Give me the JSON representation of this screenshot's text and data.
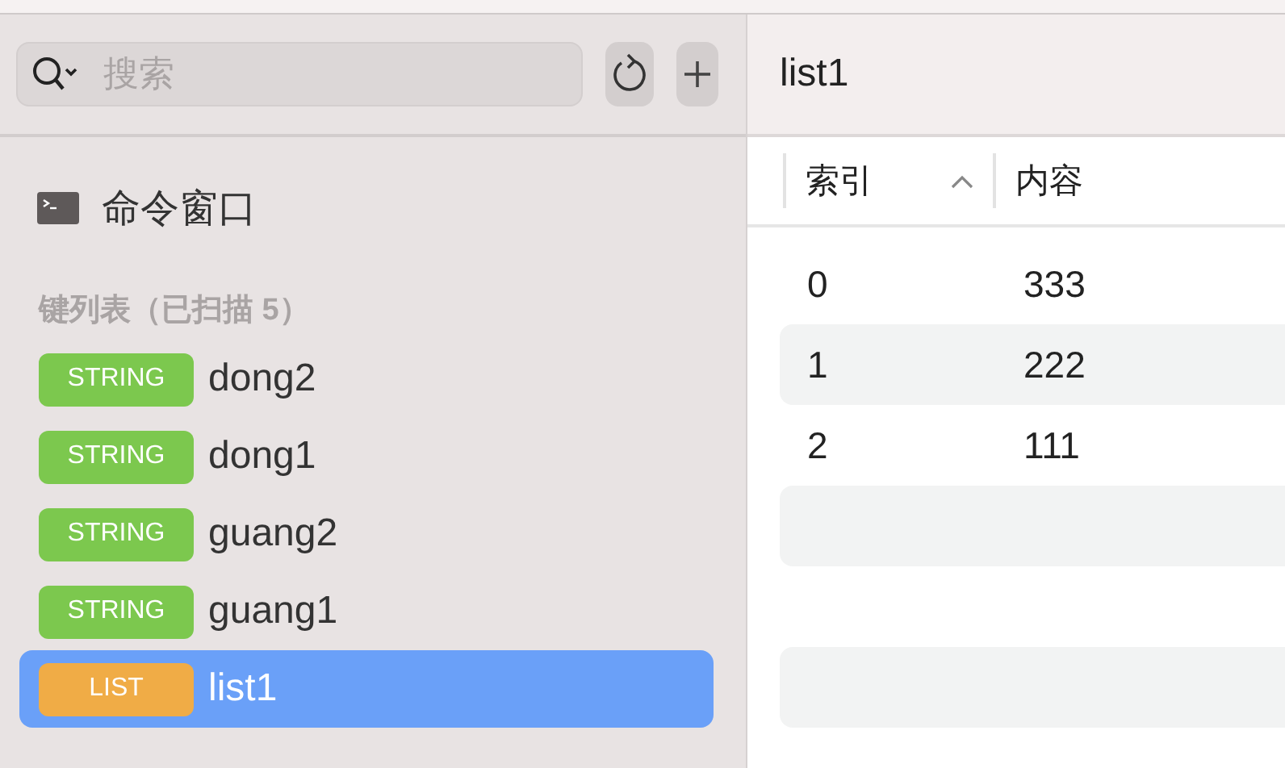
{
  "search": {
    "placeholder": "搜索"
  },
  "command_window": {
    "label": "命令窗口"
  },
  "key_list": {
    "heading": "键列表（已扫描 5）",
    "items": [
      {
        "type": "STRING",
        "name": "dong2",
        "color": "#7cc84e",
        "selected": false
      },
      {
        "type": "STRING",
        "name": "dong1",
        "color": "#7cc84e",
        "selected": false
      },
      {
        "type": "STRING",
        "name": "guang2",
        "color": "#7cc84e",
        "selected": false
      },
      {
        "type": "STRING",
        "name": "guang1",
        "color": "#7cc84e",
        "selected": false
      },
      {
        "type": "LIST",
        "name": "list1",
        "color": "#f0ac46",
        "selected": true
      }
    ]
  },
  "detail": {
    "title": "list1",
    "columns": [
      {
        "label": "索引",
        "sorted": true
      },
      {
        "label": "内容",
        "sorted": false
      }
    ],
    "rows": [
      [
        "0",
        "333"
      ],
      [
        "1",
        "222"
      ],
      [
        "2",
        "111"
      ]
    ]
  }
}
